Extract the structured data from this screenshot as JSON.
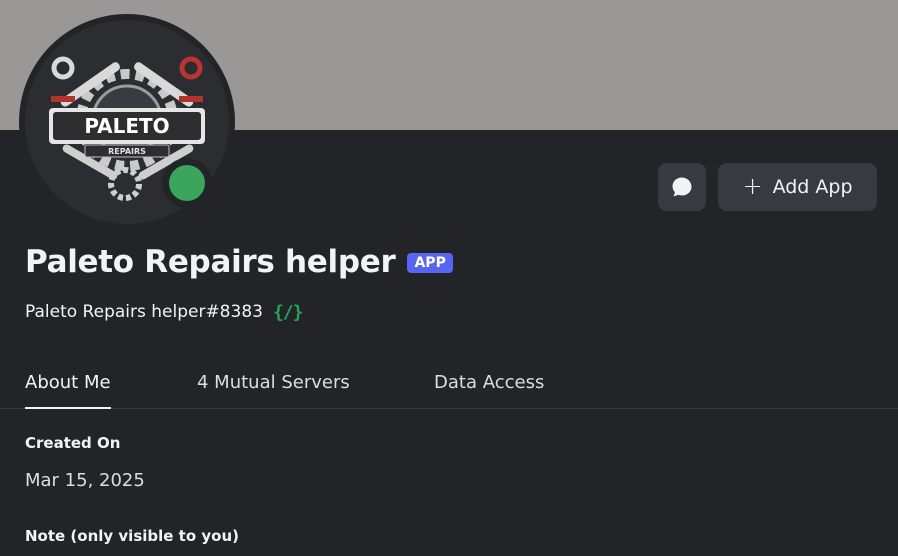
{
  "profile": {
    "display_name": "Paleto Repairs helper",
    "badge": "APP",
    "username": "Paleto Repairs helper#8383",
    "command_icon": "slash-command-icon",
    "avatar_text_main": "PALETO",
    "avatar_text_sub": "REPAIRS",
    "status": "online",
    "status_color": "#3ba55d"
  },
  "actions": {
    "message_icon": "speech-bubble-icon",
    "add_app_label": "Add App",
    "add_app_icon": "plus-icon"
  },
  "tabs": [
    {
      "label": "About Me",
      "active": true
    },
    {
      "label": "4 Mutual Servers",
      "active": false
    },
    {
      "label": "Data Access",
      "active": false
    }
  ],
  "about": {
    "created_on_label": "Created On",
    "created_on_value": "Mar 15, 2025",
    "note_label": "Note (only visible to you)"
  },
  "colors": {
    "banner": "#9a9896",
    "background": "#232428",
    "accent_badge": "#5865f2",
    "command_icon": "#23a55a"
  }
}
